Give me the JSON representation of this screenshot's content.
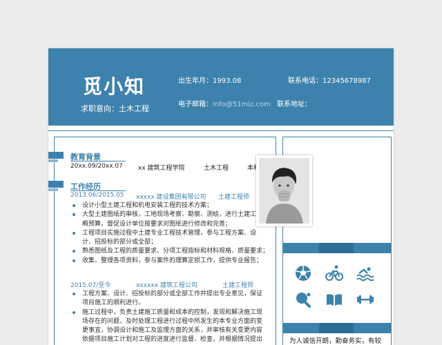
{
  "header": {
    "name": "觅小知",
    "intent_label": "求职意向：土木工程",
    "birth_label": "出生年月：",
    "birth_value": "1993.08",
    "email_label": "电子邮箱：",
    "email_value": "info@51miz.com",
    "phone_label": "联系电话：",
    "phone_value": "12345678987",
    "address_label": "联系地址："
  },
  "education": {
    "title": "教育背景",
    "period": "20xx.09/20xx.07",
    "school": "xx 建筑工程学院",
    "major": "土木工程",
    "degree": "本科"
  },
  "experience": {
    "title": "工作经历",
    "jobs": [
      {
        "period": "2013.06/2015.05",
        "company": "xxxxx 建设集团有限公司",
        "position": "土建工程师",
        "bullets": [
          "设计小型土建工程和机电安装工程的技术方案；",
          "大型土建图纸的审核，工地现场考察、勘察、测绘，进行土建工程概预算，督促设计单位按要求对图纸进行修改和完善；",
          "工程项目实施过程中土建专业工程技术管理，参与工程方案、设计、招投标的部分或全部；",
          "熟悉图纸及工程的质量要求、分项工程指标和材料规格、质量要求；",
          "收集、整理各项资料，参与案件的理算定损工作，提供专业报告；"
        ]
      },
      {
        "period": "2015.07/至今",
        "company": "xxxxxx 建筑工程公司",
        "position": "土建工程师",
        "bullets": [
          "工程方案、设计、招投标的部分或全部工作并提出专业意见，保证项目施工的顺利进行。",
          "施工过程中，负责土建施工质量和成本的控制，发现和解决施工现场存在的问题，及时处理工程进行过程中所发生的本专业方面的变更事宜，协调设计和施工及监理方面的关系，并审核有关变更内容依据项目施工计划对工程的进度进行监督、检查，并根据情况提出"
        ]
      }
    ]
  },
  "sidebar": {
    "hobbies": [
      "soccer-ball",
      "cycling",
      "swimming",
      "table-tennis",
      "reading",
      "fitness"
    ],
    "intro_text": "为人诚信开朗，勤奋务实，有较"
  },
  "colors": {
    "accent": "#3d82ad",
    "accent_dark": "#2c6d96",
    "accent_light": "#8db7d2"
  }
}
